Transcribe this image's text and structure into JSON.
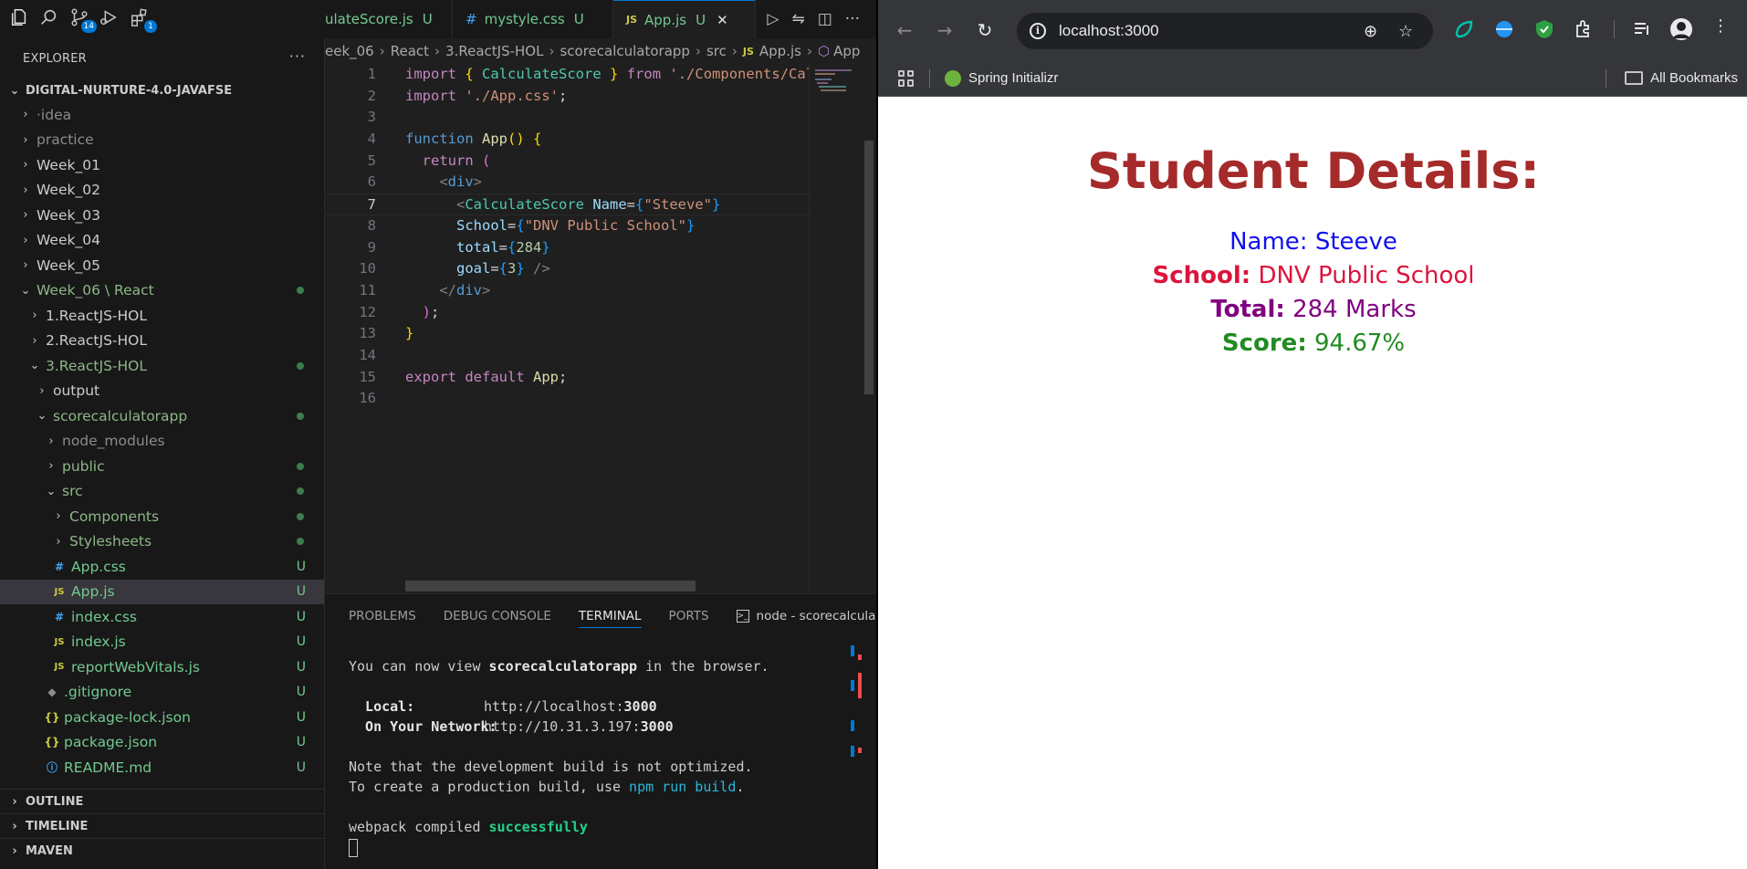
{
  "activity": {
    "source_control_badge": "14",
    "extensions_badge": "1"
  },
  "explorer": {
    "title": "EXPLORER",
    "root": "DIGITAL-NURTURE-4.0-JAVAFSE",
    "items": [
      {
        "label": "·idea",
        "depth": 0,
        "type": "folder",
        "state": "collapsed",
        "color": "grey"
      },
      {
        "label": "practice",
        "depth": 0,
        "type": "folder",
        "state": "collapsed",
        "color": "grey"
      },
      {
        "label": "Week_01",
        "depth": 0,
        "type": "folder",
        "state": "collapsed",
        "color": "normal"
      },
      {
        "label": "Week_02",
        "depth": 0,
        "type": "folder",
        "state": "collapsed",
        "color": "normal"
      },
      {
        "label": "Week_03",
        "depth": 0,
        "type": "folder",
        "state": "collapsed",
        "color": "normal"
      },
      {
        "label": "Week_04",
        "depth": 0,
        "type": "folder",
        "state": "collapsed",
        "color": "normal"
      },
      {
        "label": "Week_05",
        "depth": 0,
        "type": "folder",
        "state": "collapsed",
        "color": "normal"
      },
      {
        "label": "Week_06 \\ React",
        "depth": 0,
        "type": "folder",
        "state": "expanded",
        "color": "green",
        "dot": true
      },
      {
        "label": "1.ReactJS-HOL",
        "depth": 1,
        "type": "folder",
        "state": "collapsed",
        "color": "normal"
      },
      {
        "label": "2.ReactJS-HOL",
        "depth": 1,
        "type": "folder",
        "state": "collapsed",
        "color": "normal"
      },
      {
        "label": "3.ReactJS-HOL",
        "depth": 1,
        "type": "folder",
        "state": "expanded",
        "color": "green",
        "dot": true
      },
      {
        "label": "output",
        "depth": 2,
        "type": "folder",
        "state": "collapsed",
        "color": "normal"
      },
      {
        "label": "scorecalculatorapp",
        "depth": 2,
        "type": "folder",
        "state": "expanded",
        "color": "green",
        "dot": true
      },
      {
        "label": "node_modules",
        "depth": 3,
        "type": "folder",
        "state": "collapsed",
        "color": "grey"
      },
      {
        "label": "public",
        "depth": 3,
        "type": "folder",
        "state": "collapsed",
        "color": "green",
        "dot": true
      },
      {
        "label": "src",
        "depth": 3,
        "type": "folder",
        "state": "expanded",
        "color": "green",
        "dot": true
      },
      {
        "label": "Components",
        "depth": 4,
        "type": "folder",
        "state": "collapsed",
        "color": "green",
        "dot": true
      },
      {
        "label": "Stylesheets",
        "depth": 4,
        "type": "folder",
        "state": "collapsed",
        "color": "green",
        "dot": true
      },
      {
        "label": "App.css",
        "depth": 4,
        "type": "css",
        "icon": "#",
        "color": "green",
        "badge": "U"
      },
      {
        "label": "App.js",
        "depth": 4,
        "type": "js",
        "icon": "JS",
        "color": "green",
        "badge": "U",
        "selected": true
      },
      {
        "label": "index.css",
        "depth": 4,
        "type": "css",
        "icon": "#",
        "color": "green",
        "badge": "U"
      },
      {
        "label": "index.js",
        "depth": 4,
        "type": "js",
        "icon": "JS",
        "color": "green",
        "badge": "U"
      },
      {
        "label": "reportWebVitals.js",
        "depth": 4,
        "type": "js",
        "icon": "JS",
        "color": "green",
        "badge": "U"
      },
      {
        "label": ".gitignore",
        "depth": 3,
        "type": "git",
        "icon": "◆",
        "color": "green",
        "badge": "U"
      },
      {
        "label": "package-lock.json",
        "depth": 3,
        "type": "json",
        "icon": "{}",
        "color": "green",
        "badge": "U"
      },
      {
        "label": "package.json",
        "depth": 3,
        "type": "json",
        "icon": "{}",
        "color": "green",
        "badge": "U"
      },
      {
        "label": "README.md",
        "depth": 3,
        "type": "info",
        "icon": "ⓘ",
        "color": "green",
        "badge": "U"
      }
    ],
    "sections": [
      "OUTLINE",
      "TIMELINE",
      "MAVEN"
    ]
  },
  "tabs": [
    {
      "icon": "JS",
      "label": "ulateScore.js",
      "status": "U",
      "active": false
    },
    {
      "icon": "#",
      "label": "mystyle.css",
      "status": "U",
      "active": false
    },
    {
      "icon": "JS",
      "label": "App.js",
      "status": "U",
      "active": true,
      "close": "✕"
    }
  ],
  "breadcrumb": [
    "eek_06",
    "React",
    "3.ReactJS-HOL",
    "scorecalculatorapp",
    "src",
    "App.js",
    "App"
  ],
  "editor": {
    "lines": [
      {
        "n": "1"
      },
      {
        "n": "2"
      },
      {
        "n": "3"
      },
      {
        "n": "4"
      },
      {
        "n": "5"
      },
      {
        "n": "6"
      },
      {
        "n": "7"
      },
      {
        "n": "8"
      },
      {
        "n": "9"
      },
      {
        "n": "10"
      },
      {
        "n": "11"
      },
      {
        "n": "12"
      },
      {
        "n": "13"
      },
      {
        "n": "14"
      },
      {
        "n": "15"
      },
      {
        "n": "16"
      }
    ],
    "current_line": 7
  },
  "panel": {
    "tabs": [
      "PROBLEMS",
      "DEBUG CONSOLE",
      "TERMINAL",
      "PORTS"
    ],
    "active_tab": "TERMINAL",
    "terminal_name": "node - scorecalculatorapp",
    "terminal": {
      "l1_a": "You can now view ",
      "l1_b": "scorecalculatorapp",
      "l1_c": " in the browser.",
      "local_label": "  Local:",
      "local_url_a": "http://localhost:",
      "local_url_b": "3000",
      "network_label": "  On Your Network:",
      "network_url_a": "http://10.31.3.197:",
      "network_url_b": "3000",
      "note1": "Note that the development build is not optimized.",
      "note2_a": "To create a production build, use ",
      "note2_b": "npm run build",
      "note2_c": ".",
      "compiled_a": "webpack compiled ",
      "compiled_b": "successfully"
    }
  },
  "browser": {
    "url": "localhost:3000",
    "bookmarks": {
      "item": "Spring Initializr",
      "all": "All Bookmarks"
    },
    "page": {
      "heading": "Student Details:",
      "name_label": "Name:",
      "name_value": "Steeve",
      "school_label": "School:",
      "school_value": "DNV Public School",
      "total_label": "Total:",
      "total_value": "284 Marks",
      "score_label": "Score:",
      "score_value": "94.67%"
    },
    "colors": {
      "heading": "#a52a2a",
      "name": "#1010ee",
      "school": "#dc143c",
      "total": "#800080",
      "score": "#228b22"
    }
  }
}
